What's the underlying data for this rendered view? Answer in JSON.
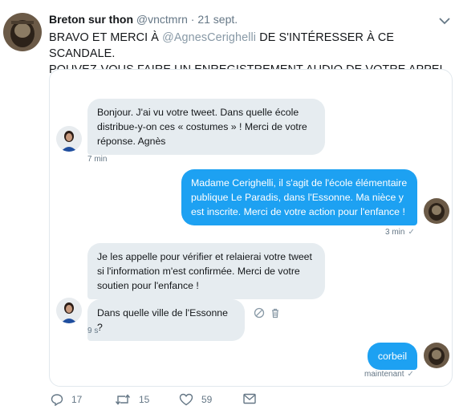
{
  "tweet": {
    "author_name": "Breton sur thon",
    "author_handle": "@vnctmrn",
    "separator": "·",
    "date": "21 sept.",
    "text_line1_pre": "BRAVO ET MERCI À ",
    "mention": "@AgnesCerighelli",
    "text_line1_post": " DE S'INTÉRESSER À CE SCANDALE.",
    "text_line2": "POUVEZ-VOUS FAIRE UN ENREGISTREMENT AUDIO DE VOTRE APPEL ?"
  },
  "conversation": {
    "messages": [
      {
        "from": "in",
        "text": "Bonjour. J'ai vu votre tweet. Dans quelle école distribue-y-on ces « costumes » ! Merci de votre réponse. Agnès",
        "time": "7 min"
      },
      {
        "from": "out",
        "text": "Madame Cerighelli, il s'agit de l'école élémentaire publique Le Paradis, dans l'Essonne. Ma nièce y est inscrite. Merci de votre action pour l'enfance !",
        "time": "3 min",
        "check": "✓"
      },
      {
        "from": "in",
        "text": "Je les appelle pour vérifier et relaierai votre tweet si l'information m'est confirmée. Merci de votre soutien pour l'enfance !",
        "time": ""
      },
      {
        "from": "in",
        "text": "Dans quelle ville de l'Essonne ?",
        "time": "9 s"
      },
      {
        "from": "out",
        "text": "corbeil",
        "time": "maintenant",
        "check": "✓"
      }
    ]
  },
  "actions": {
    "reply_count": "17",
    "retweet_count": "15",
    "like_count": "59"
  },
  "colors": {
    "accent": "#1da1f2",
    "incoming_bubble": "#e6ecf0",
    "muted_text": "#657786"
  }
}
